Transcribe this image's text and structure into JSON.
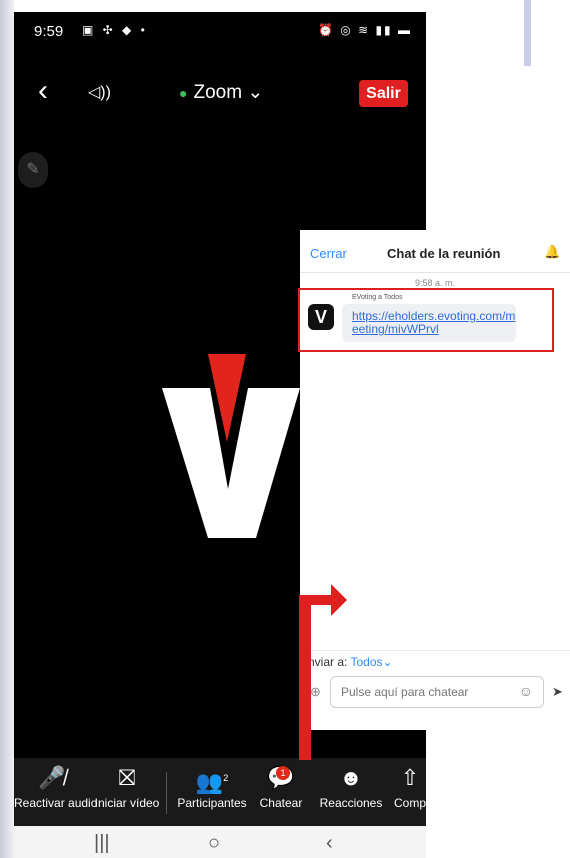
{
  "status_bar": {
    "time": "9:59"
  },
  "meeting": {
    "title": "Zoom",
    "leave_label": "Salir"
  },
  "chat": {
    "close_label": "Cerrar",
    "title": "Chat de la reunión",
    "timestamp": "9:58 a. m.",
    "message": {
      "sender": "EVoting a Todos",
      "link": "https://eholders.evoting.com/meeting/mivWPrvl"
    },
    "send_to_label": "Enviar a:",
    "send_to_value": "Todos",
    "input_placeholder": "Pulse aquí para chatear"
  },
  "toolbar": {
    "items": [
      {
        "label": "Reactivar audio",
        "icon": "muted-mic-icon"
      },
      {
        "label": "Iniciar vídeo",
        "icon": "video-off-icon"
      },
      {
        "label": "Participantes",
        "icon": "participants-icon",
        "count": "2"
      },
      {
        "label": "Chatear",
        "icon": "chat-icon",
        "badge": "1"
      },
      {
        "label": "Reacciones",
        "icon": "reactions-icon"
      },
      {
        "label": "Compartir",
        "icon": "share-icon"
      }
    ]
  },
  "colors": {
    "accent": "#2d8cff",
    "danger": "#e02020",
    "background": "#000000"
  }
}
